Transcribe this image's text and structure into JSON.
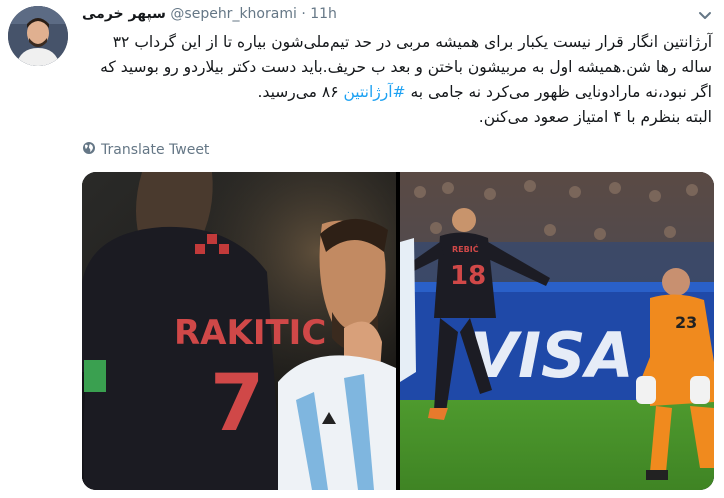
{
  "author": {
    "display_name": "سپهر خرمی",
    "handle": "@sepehr_khorami",
    "separator": "·",
    "time": "11h"
  },
  "tweet": {
    "text_before": "آرژانتین انگار قرار نیست یکبار برای همیشه مربی در حد تیم‌ملی‌شون بیاره تا از این گرداب ۳۲ ساله رها شن.همیشه اول به مربیشون باختن و بعد ب حریف.باید دست دکتر بیلاردو رو بوسید که اگر نبود،نه مارادونایی ظهور می‌کرد نه جامی به ",
    "hashtag": "#آرژانتین",
    "text_after": " ۸۶ می‌رسید.",
    "last_line": "البته بنظرم با ۴ امتیاز صعود می‌کنن."
  },
  "translate_label": "Translate Tweet",
  "media": {
    "left_photo": {
      "jersey_name": "RAKITIC",
      "jersey_number": "7"
    },
    "right_photo": {
      "jersey_name": "REBIĆ",
      "jersey_number": "18",
      "keeper_number": "23",
      "board_text": "VISA"
    }
  },
  "icons": {
    "avatar": "profile-avatar",
    "caret": "chevron-down-icon",
    "translate": "globe-icon"
  },
  "colors": {
    "link": "#1da1f2",
    "muted": "#657786",
    "text": "#14171a"
  }
}
